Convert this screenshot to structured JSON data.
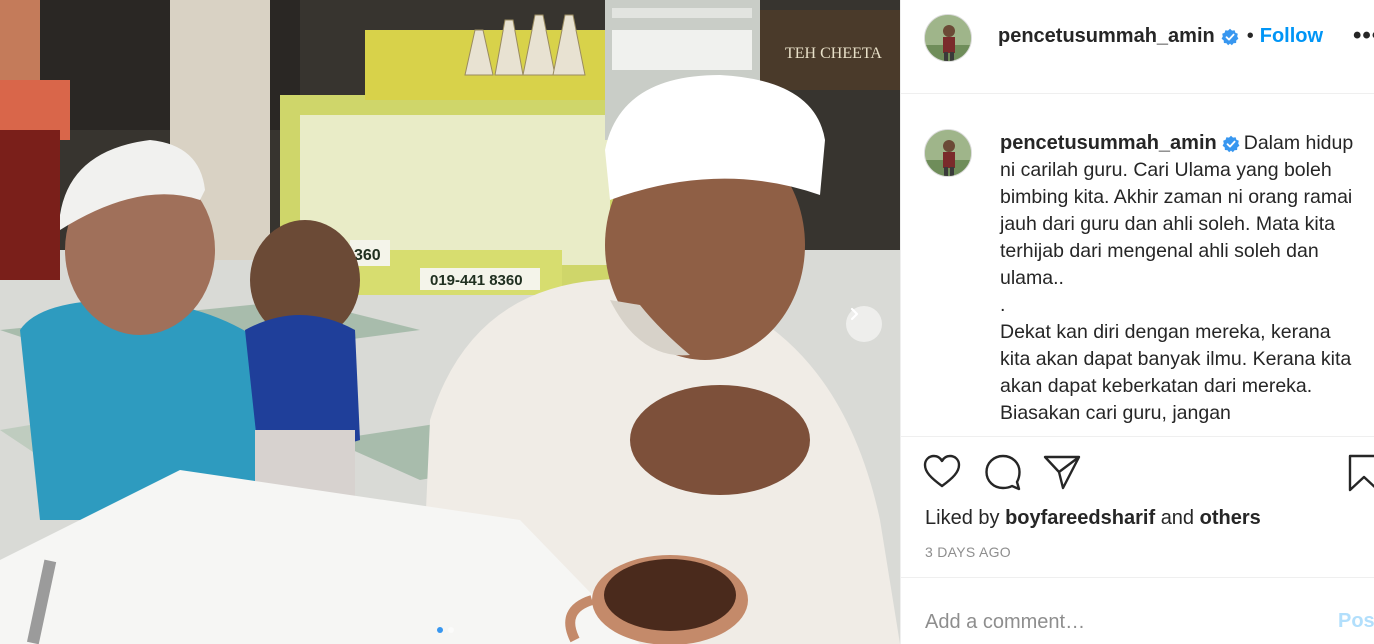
{
  "post": {
    "username": "pencetusummah_amin",
    "verified": true,
    "follow_label": "Follow",
    "separator": "•",
    "more_label": "•••",
    "photo_sign_text": "019-441 8360",
    "photo_sign_partial": "360",
    "photo_shop_sign": "TEH CHEETA",
    "carousel": {
      "slides": 2,
      "active_index": 0
    }
  },
  "caption": {
    "username": "pencetusummah_amin",
    "paragraph_1": "Dalam hidup ni carilah guru. Cari Ulama yang boleh bimbing kita. Akhir zaman ni orang ramai jauh dari guru dan ahli soleh. Mata kita terhijab dari mengenal ahli soleh dan ulama..",
    "dot_line": ".",
    "paragraph_2": "Dekat kan diri dengan mereka, kerana kita akan dapat banyak ilmu. Kerana kita akan dapat keberkatan dari mereka. Biasakan cari guru, jangan"
  },
  "actions": {
    "icons": [
      "heart-icon",
      "comment-icon",
      "share-icon",
      "bookmark-icon"
    ]
  },
  "likes": {
    "prefix": "Liked by",
    "user": "boyfareedsharif",
    "and": "and",
    "others": "others"
  },
  "timestamp": "3 DAYS AGO",
  "comment": {
    "placeholder": "Add a comment…",
    "post_label": "Post"
  },
  "colors": {
    "accent": "#0095f6",
    "verified": "#3897f0",
    "post_disabled": "#b2dffc",
    "muted": "#8e8e8e",
    "border": "#efefef"
  }
}
